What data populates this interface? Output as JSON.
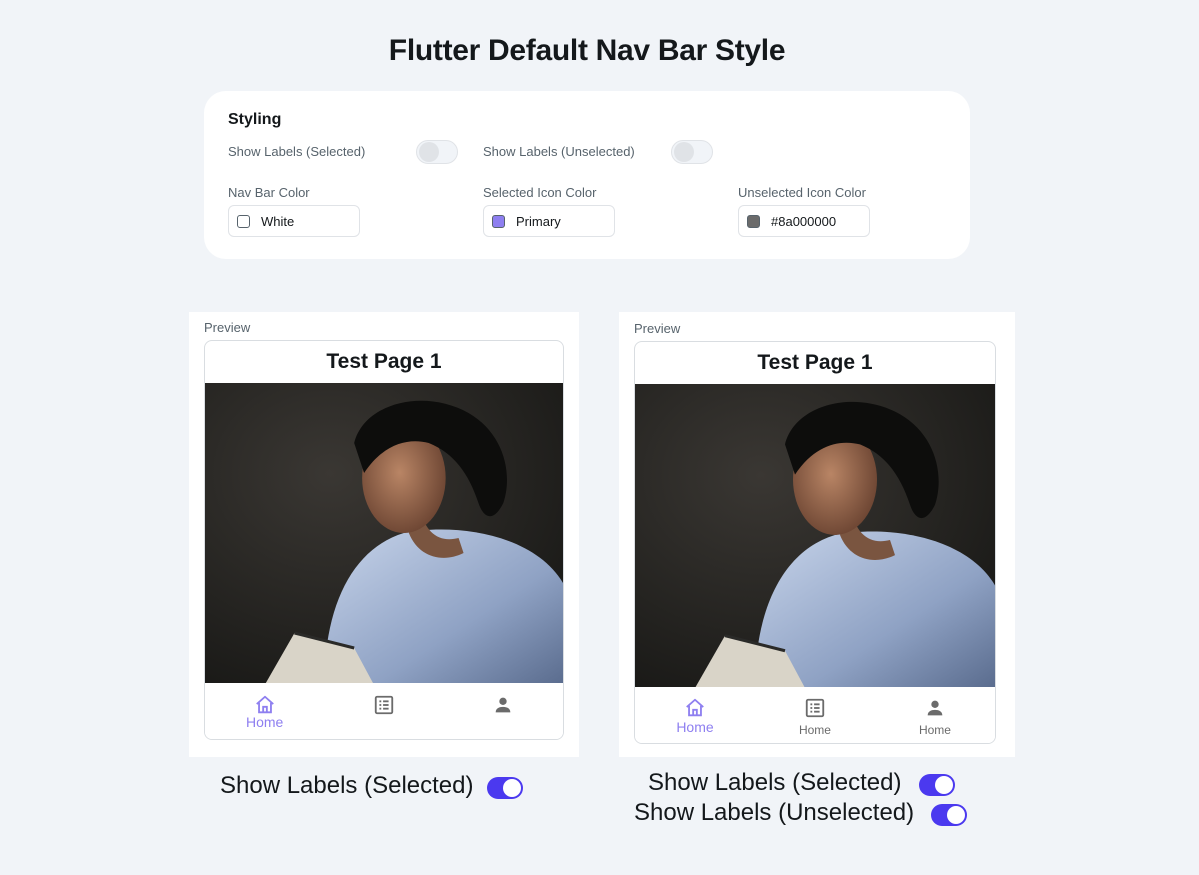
{
  "page": {
    "title": "Flutter Default Nav Bar Style"
  },
  "styling": {
    "heading": "Styling",
    "show_labels_selected": {
      "label": "Show Labels (Selected)",
      "on": false
    },
    "show_labels_unselected": {
      "label": "Show Labels (Unselected)",
      "on": false
    },
    "nav_bar_color": {
      "label": "Nav Bar Color",
      "value": "White",
      "swatch": "#ffffff"
    },
    "selected_icon_color": {
      "label": "Selected Icon Color",
      "value": "Primary",
      "swatch": "#8e7ff0"
    },
    "unselected_icon_color": {
      "label": "Unselected Icon Color",
      "value": "#8a000000",
      "swatch": "#6b6b6b"
    }
  },
  "previews": [
    {
      "label": "Preview",
      "page_title": "Test Page 1",
      "nav_items": [
        {
          "icon": "home-icon",
          "label": "Home",
          "selected": true
        },
        {
          "icon": "list-icon",
          "label": "",
          "selected": false
        },
        {
          "icon": "person-icon",
          "label": "",
          "selected": false
        }
      ],
      "caption_lines": [
        {
          "text": "Show Labels (Selected)",
          "toggle": true
        }
      ]
    },
    {
      "label": "Preview",
      "page_title": "Test Page 1",
      "nav_items": [
        {
          "icon": "home-icon",
          "label": "Home",
          "selected": true
        },
        {
          "icon": "list-icon",
          "label": "Home",
          "selected": false
        },
        {
          "icon": "person-icon",
          "label": "Home",
          "selected": false
        }
      ],
      "caption_lines": [
        {
          "text": "Show Labels (Selected)",
          "toggle": true
        },
        {
          "text": "Show Labels (Unselected)",
          "toggle": true
        }
      ]
    }
  ],
  "colors": {
    "primary": "#8e7ff0",
    "unselected": "#6b6b6b",
    "toggle_on": "#4b39ef"
  }
}
